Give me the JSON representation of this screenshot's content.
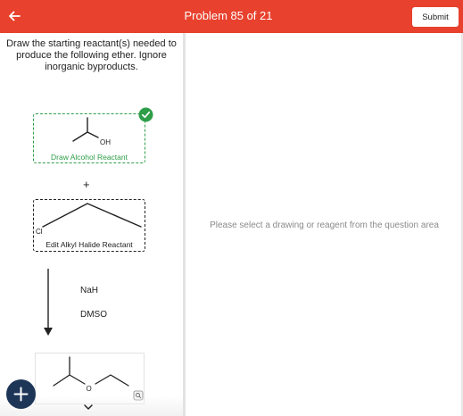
{
  "header": {
    "title": "Problem 85 of 21",
    "submit_label": "Submit",
    "color": "#e8412d"
  },
  "question": {
    "prompt": "Draw the starting reactant(s) needed to produce the following ether. Ignore inorganic byproducts."
  },
  "reactants": {
    "alcohol": {
      "label": "Draw Alcohol Reactant",
      "atom_label": "OH",
      "status": "complete",
      "color": "#2e9e48"
    },
    "plus": "+",
    "halide": {
      "label": "Edit Alkyl Halide Reactant",
      "atom_label": "Cl"
    }
  },
  "reagents": [
    "NaH",
    "DMSO"
  ],
  "product": {
    "atom_label": "O"
  },
  "right_panel": {
    "placeholder": "Please select a drawing or reagent from the question area"
  },
  "icons": {
    "back": "arrow-left-icon",
    "check": "check-circle-icon",
    "add": "plus-icon",
    "zoom": "magnifier-icon",
    "scroll": "chevron-down-icon"
  }
}
